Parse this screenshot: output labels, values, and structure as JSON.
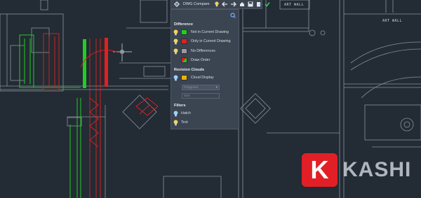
{
  "toolbar": {
    "title": "DWG Compare",
    "icons": [
      "gear-icon",
      "lightbulb-icon",
      "arrow-left-icon",
      "arrow-right-icon",
      "home-icon",
      "save-snapshot-icon",
      "export-icon",
      "check-icon"
    ]
  },
  "panel": {
    "difference": {
      "title": "Difference",
      "items": [
        {
          "label": "Not in Current Drawing",
          "color": "#22cc22"
        },
        {
          "label": "Only in Current Drawing",
          "color": "#e02020"
        },
        {
          "label": "No Differences",
          "color": "#9a9a9a"
        },
        {
          "label": "Draw Order",
          "color": "split-red-green"
        }
      ]
    },
    "revision_clouds": {
      "title": "Revision Clouds",
      "cloud_display": {
        "label": "Cloud Display",
        "color": "#f0b000"
      },
      "shape_select": {
        "value": "Polygonal"
      },
      "size_field": {
        "value": "Size"
      }
    },
    "filters": {
      "title": "Filters",
      "items": [
        {
          "label": "Hatch"
        },
        {
          "label": "Text"
        }
      ]
    }
  },
  "drawing": {
    "labels": {
      "art_wall_top": "ART WALL",
      "art_wall": "ART WALL"
    }
  },
  "brand": {
    "logo_letter": "K",
    "name": "KASHI"
  },
  "colors": {
    "background": "#232b34",
    "line": "#9aa4b0",
    "green": "#22cc22",
    "red": "#e02020",
    "cloud_yellow": "#f0b000"
  }
}
